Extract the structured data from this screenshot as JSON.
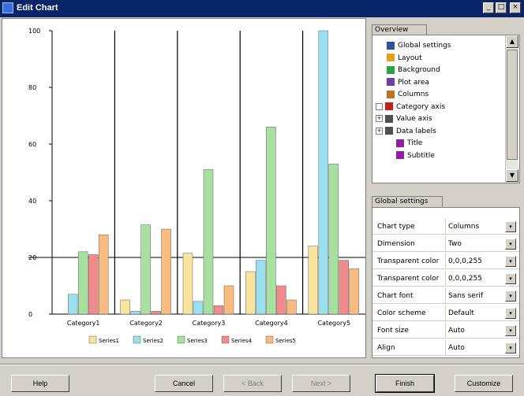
{
  "window": {
    "title": "Edit Chart",
    "controls": [
      "_",
      "□",
      "×"
    ]
  },
  "tree": {
    "tab_label": "Overview",
    "items": [
      {
        "label": "Global settings",
        "icon": "settings-icon",
        "indent": 1,
        "expander": ""
      },
      {
        "label": "Layout",
        "icon": "layout-icon",
        "indent": 1,
        "expander": ""
      },
      {
        "label": "Background",
        "icon": "background-icon",
        "indent": 1,
        "expander": ""
      },
      {
        "label": "Plot area",
        "icon": "plot-area-icon",
        "indent": 1,
        "expander": ""
      },
      {
        "label": "Columns",
        "icon": "columns-icon",
        "indent": 1,
        "expander": ""
      },
      {
        "label": "Category axis",
        "icon": "category-axis-icon",
        "indent": 1,
        "expander": "check"
      },
      {
        "label": "Value axis",
        "icon": "value-axis-icon",
        "indent": 1,
        "expander": "+"
      },
      {
        "label": "Data labels",
        "icon": "data-labels-icon",
        "indent": 1,
        "expander": "+"
      },
      {
        "label": "Title",
        "icon": "title-icon",
        "indent": 2,
        "expander": ""
      },
      {
        "label": "Subtitle",
        "icon": "subtitle-icon",
        "indent": 2,
        "expander": ""
      }
    ]
  },
  "properties": {
    "tab_label": "Global settings",
    "rows": [
      {
        "label": "Chart type",
        "value": "Columns"
      },
      {
        "label": "Dimension",
        "value": "Two"
      },
      {
        "label": "Transparent color",
        "value": "0,0,0,255"
      },
      {
        "label": "Transparent color",
        "value": "0,0,0,255"
      },
      {
        "label": "Chart font",
        "value": "Sans serif"
      },
      {
        "label": "Color scheme",
        "value": "Default"
      },
      {
        "label": "Font size",
        "value": "Auto"
      },
      {
        "label": "Align",
        "value": "Auto"
      }
    ]
  },
  "buttons": {
    "help": "Help",
    "cancel": "Cancel",
    "back": "< Back",
    "next": "Next >",
    "finish": "Finish",
    "customize": "Customize"
  },
  "chart_data": {
    "type": "bar",
    "categories": [
      "Category1",
      "Category2",
      "Category3",
      "Category4",
      "Category5"
    ],
    "series": [
      {
        "name": "Series1",
        "color": "#f8e49c",
        "values": [
          0,
          5,
          21.5,
          15,
          24
        ]
      },
      {
        "name": "Series2",
        "color": "#9ce0f0",
        "values": [
          7,
          1,
          4.5,
          19,
          100
        ]
      },
      {
        "name": "Series3",
        "color": "#a8e0a0",
        "values": [
          22,
          31.5,
          51,
          66,
          53
        ]
      },
      {
        "name": "Series4",
        "color": "#f08c8c",
        "values": [
          21,
          1,
          3,
          10,
          19
        ]
      },
      {
        "name": "Series5",
        "color": "#f8bc80",
        "values": [
          28,
          30,
          10,
          5,
          16
        ]
      }
    ],
    "ylim": [
      0,
      100
    ],
    "yticks": [
      "100",
      "80",
      "60",
      "40",
      "20",
      "0"
    ],
    "reference_lines": [
      20
    ],
    "grid": false,
    "legend": "bottom"
  }
}
